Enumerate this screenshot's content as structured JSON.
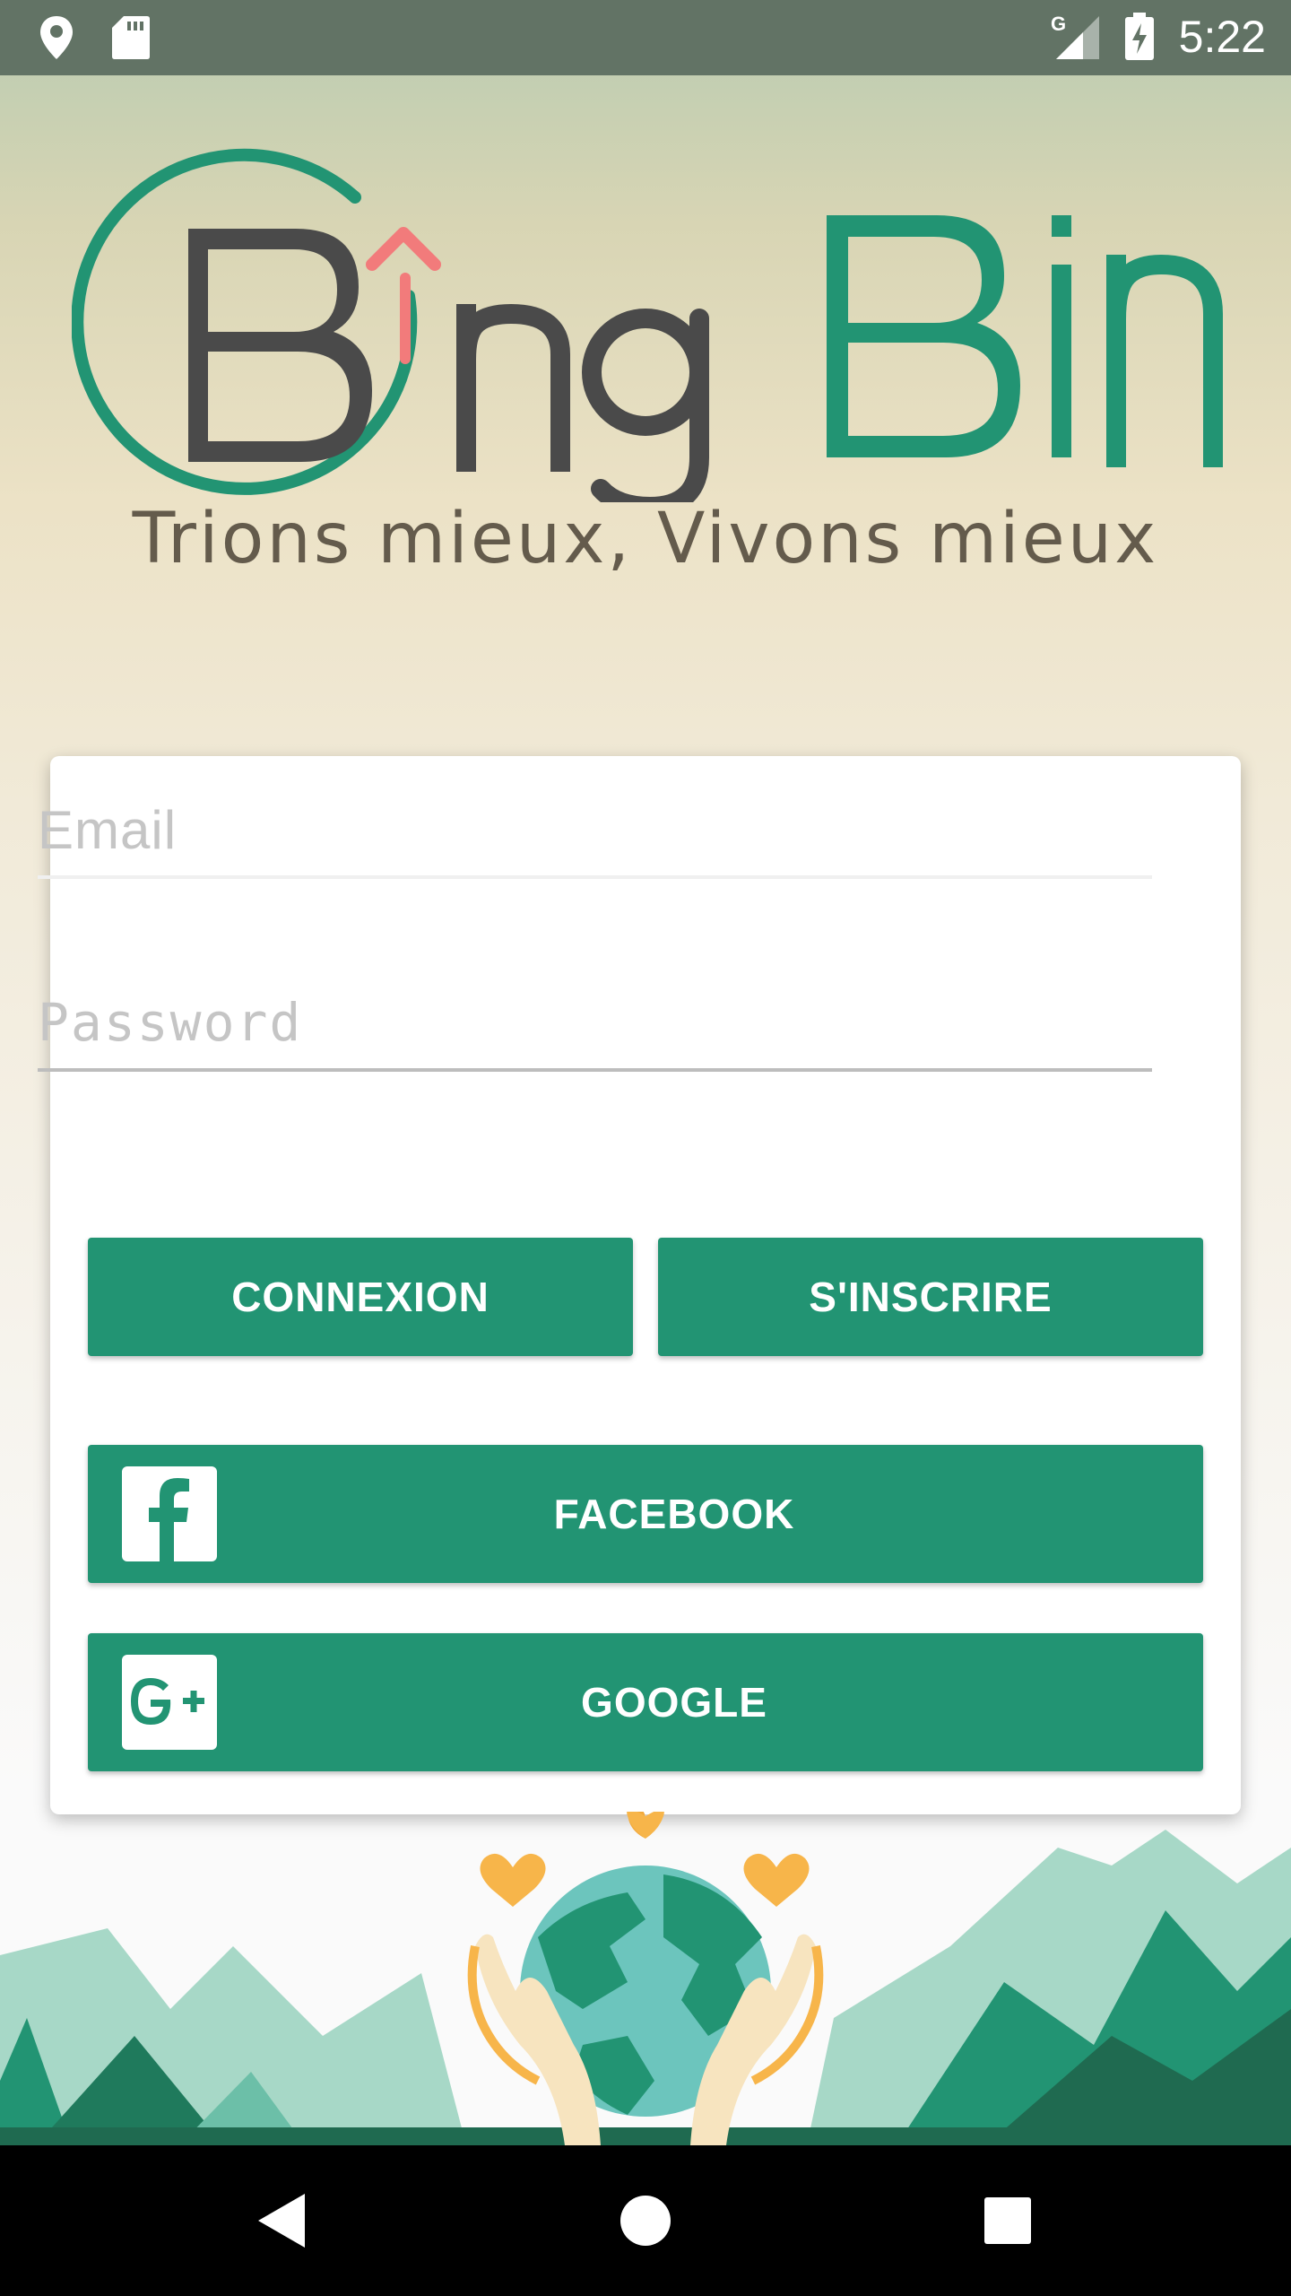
{
  "status_bar": {
    "time": "5:22",
    "network_label": "G",
    "icons": [
      "location-icon",
      "sd-card-icon",
      "signal-icon",
      "battery-charging-icon"
    ]
  },
  "logo": {
    "text_dark": "B ng",
    "text_green": "Bin",
    "full_name": "BingBin"
  },
  "tagline": "Trions mieux, Vivons mieux",
  "login_form": {
    "email_placeholder": "Email",
    "password_placeholder": "Password",
    "email_value": "",
    "password_value": ""
  },
  "buttons": {
    "connexion": "CONNEXION",
    "inscrire": "S'INSCRIRE",
    "facebook": "FACEBOOK",
    "google": "GOOGLE"
  },
  "colors": {
    "brand_green": "#229473",
    "logo_dark": "#4a4a4a",
    "arrow_pink": "#f27b7b",
    "status_bar": "#627365"
  },
  "nav_bar": {
    "icons": [
      "back-icon",
      "home-icon",
      "recents-icon"
    ]
  }
}
